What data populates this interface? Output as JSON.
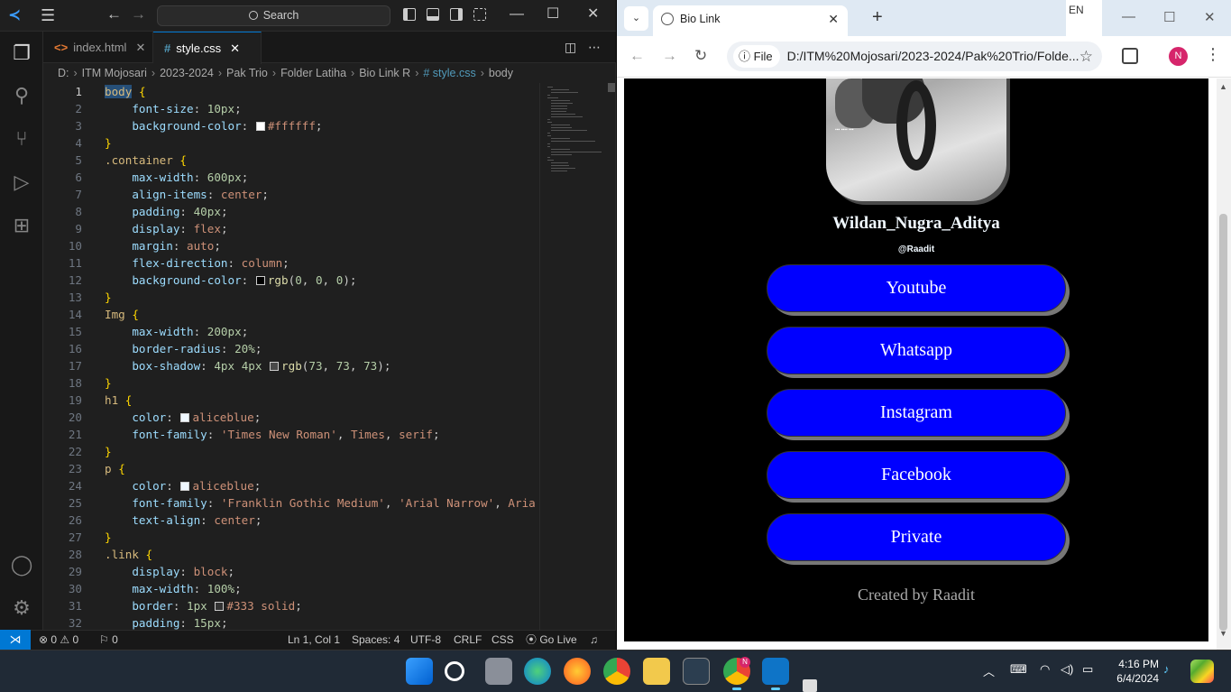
{
  "vscode": {
    "search_label": "Search",
    "tabs": [
      {
        "icon": "<>",
        "label": "index.html"
      },
      {
        "icon": "#",
        "label": "style.css"
      }
    ],
    "breadcrumbs": [
      "D:",
      "ITM Mojosari",
      "2023-2024",
      "Pak Trio",
      "Folder Latiha",
      "Bio Link R",
      "# style.css",
      "body"
    ],
    "lines": [
      {
        "n": "1",
        "html": "<span class='t-sel' style='background:#264f78'>body</span> <span class='t-br'>{</span>"
      },
      {
        "n": "2",
        "html": "    <span class='t-prop'>font-size</span>: <span class='t-num'>10px</span>;"
      },
      {
        "n": "3",
        "html": "    <span class='t-prop'>background-color</span>: <span class='sw' style='background:#ffffff'></span><span class='t-val'>#ffffff</span>;"
      },
      {
        "n": "4",
        "html": "<span class='t-br'>}</span>"
      },
      {
        "n": "5",
        "html": "<span class='t-sel'>.container</span> <span class='t-br'>{</span>"
      },
      {
        "n": "6",
        "html": "    <span class='t-prop'>max-width</span>: <span class='t-num'>600px</span>;"
      },
      {
        "n": "7",
        "html": "    <span class='t-prop'>align-items</span>: <span class='t-val'>center</span>;"
      },
      {
        "n": "8",
        "html": "    <span class='t-prop'>padding</span>: <span class='t-num'>40px</span>;"
      },
      {
        "n": "9",
        "html": "    <span class='t-prop'>display</span>: <span class='t-val'>flex</span>;"
      },
      {
        "n": "10",
        "html": "    <span class='t-prop'>margin</span>: <span class='t-val'>auto</span>;"
      },
      {
        "n": "11",
        "html": "    <span class='t-prop'>flex-direction</span>: <span class='t-val'>column</span>;"
      },
      {
        "n": "12",
        "html": "    <span class='t-prop'>background-color</span>: <span class='sw' style='background:#000'></span><span class='t-fn'>rgb</span>(<span class='t-num'>0</span>, <span class='t-num'>0</span>, <span class='t-num'>0</span>);"
      },
      {
        "n": "13",
        "html": "<span class='t-br'>}</span>"
      },
      {
        "n": "14",
        "html": "<span class='t-sel'>Img</span> <span class='t-br'>{</span>"
      },
      {
        "n": "15",
        "html": "    <span class='t-prop'>max-width</span>: <span class='t-num'>200px</span>;"
      },
      {
        "n": "16",
        "html": "    <span class='t-prop'>border-radius</span>: <span class='t-num'>20%</span>;"
      },
      {
        "n": "17",
        "html": "    <span class='t-prop'>box-shadow</span>: <span class='t-num'>4px</span> <span class='t-num'>4px</span> <span class='sw' style='background:#494949'></span><span class='t-fn'>rgb</span>(<span class='t-num'>73</span>, <span class='t-num'>73</span>, <span class='t-num'>73</span>);"
      },
      {
        "n": "18",
        "html": "<span class='t-br'>}</span>"
      },
      {
        "n": "19",
        "html": "<span class='t-sel'>h1</span> <span class='t-br'>{</span>"
      },
      {
        "n": "20",
        "html": "    <span class='t-prop'>color</span>: <span class='sw' style='background:#f0f8ff'></span><span class='t-val'>aliceblue</span>;"
      },
      {
        "n": "21",
        "html": "    <span class='t-prop'>font-family</span>: <span class='t-str'>'Times New Roman'</span>, <span class='t-val'>Times</span>, <span class='t-val'>serif</span>;"
      },
      {
        "n": "22",
        "html": "<span class='t-br'>}</span>"
      },
      {
        "n": "23",
        "html": "<span class='t-sel'>p</span> <span class='t-br'>{</span>"
      },
      {
        "n": "24",
        "html": "    <span class='t-prop'>color</span>: <span class='sw' style='background:#f0f8ff'></span><span class='t-val'>aliceblue</span>;"
      },
      {
        "n": "25",
        "html": "    <span class='t-prop'>font-family</span>: <span class='t-str'>'Franklin Gothic Medium'</span>, <span class='t-str'>'Arial Narrow'</span>, <span class='t-val'>Aria</span>"
      },
      {
        "n": "26",
        "html": "    <span class='t-prop'>text-align</span>: <span class='t-val'>center</span>;"
      },
      {
        "n": "27",
        "html": "<span class='t-br'>}</span>"
      },
      {
        "n": "28",
        "html": "<span class='t-sel'>.link</span> <span class='t-br'>{</span>"
      },
      {
        "n": "29",
        "html": "    <span class='t-prop'>display</span>: <span class='t-val'>block</span>;"
      },
      {
        "n": "30",
        "html": "    <span class='t-prop'>max-width</span>: <span class='t-num'>100%</span>;"
      },
      {
        "n": "31",
        "html": "    <span class='t-prop'>border</span>: <span class='t-num'>1px</span> <span class='sw' style='background:#333'></span><span class='t-val'>#333</span> <span class='t-val'>solid</span>;"
      },
      {
        "n": "32",
        "html": "    <span class='t-prop'>padding</span>: <span class='t-num'>15px</span>;"
      }
    ],
    "status": {
      "errors": "0",
      "warnings": "0",
      "ports": "0",
      "position": "Ln 1, Col 1",
      "spaces": "Spaces: 4",
      "encoding": "UTF-8",
      "eol": "CRLF",
      "language": "CSS",
      "golive": "Go Live"
    }
  },
  "browser": {
    "tab_title": "Bio Link",
    "lang_indicator": "EN",
    "file_chip": "File",
    "url": "D:/ITM%20Mojosari/2023-2024/Pak%20Trio/Folde...",
    "profile_initial": "N",
    "page": {
      "name": "Wildan_Nugra_Aditya",
      "handle": "@Raadit",
      "links": [
        "Youtube",
        "Whatsapp",
        "Instagram",
        "Facebook",
        "Private"
      ],
      "credit": "Created by Raadit"
    }
  },
  "taskbar": {
    "time": "4:16 PM",
    "date": "6/4/2024",
    "notify_badge": "N"
  },
  "colors": {
    "vscode_accent": "#0078d4",
    "link_blue": "#0000ff",
    "chrome_tab_bg": "#dfe9f3"
  }
}
